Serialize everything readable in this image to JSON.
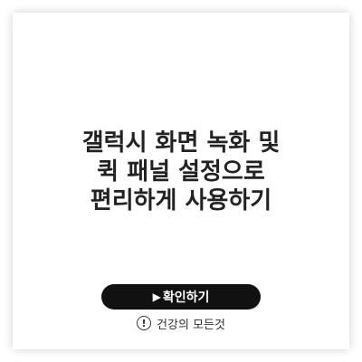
{
  "title": {
    "line1": "갤럭시 화면 녹화 및",
    "line2": "퀵 패널 설정으로",
    "line3": "편리하게 사용하기"
  },
  "cta": {
    "icon": "play-icon",
    "label": "확인하기"
  },
  "footer": {
    "icon": "warning-circle-icon",
    "text": "건강의 모든것"
  },
  "colors": {
    "background": "#ffffff",
    "title": "#222222",
    "button_bg": "#111111",
    "button_text": "#ffffff"
  }
}
